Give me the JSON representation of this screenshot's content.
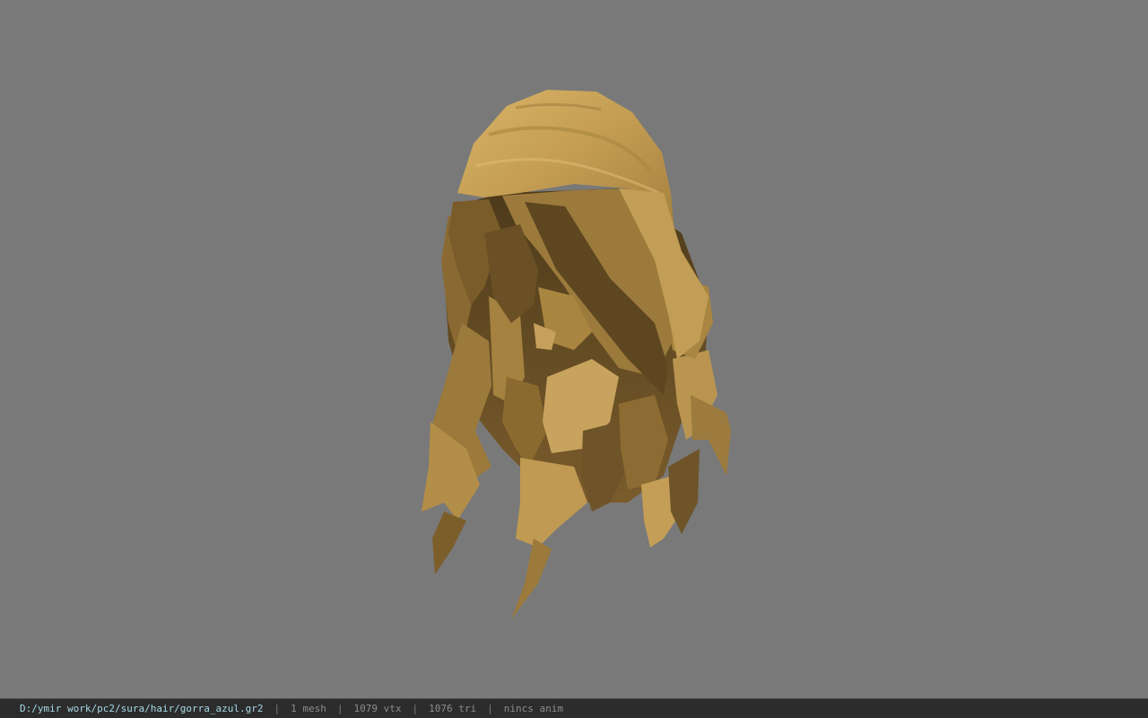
{
  "viewer": {
    "background_color": "#797979",
    "model_name": "hair mesh"
  },
  "status_bar": {
    "file_path": "D:/ymir work/pc2/sura/hair/gorra_azul.gr2",
    "separator": "|",
    "mesh_count": "1 mesh",
    "vertex_count": "1079 vtx",
    "triangle_count": "1076 tri",
    "animation": "nincs anim"
  },
  "colors": {
    "hair_light": "#c9a45a",
    "hair_mid": "#a98440",
    "hair_dark": "#6e5428",
    "hair_shadow": "#4d3a1a",
    "status_bg": "#2c2c2c",
    "status_path": "#a6d8e6"
  }
}
